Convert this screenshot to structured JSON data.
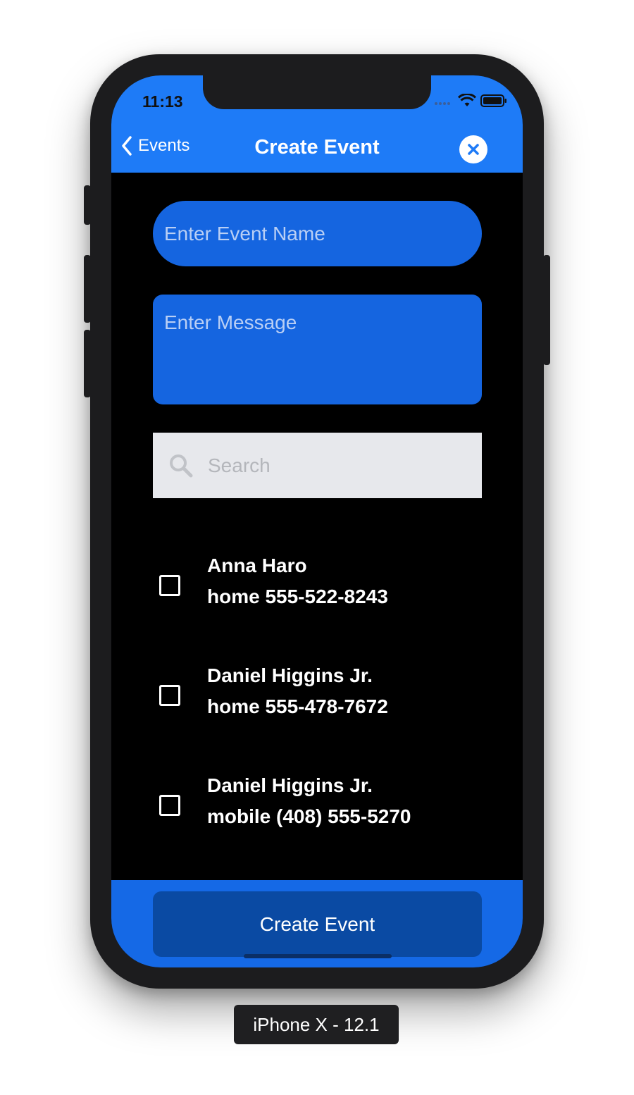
{
  "status_bar": {
    "time": "11:13"
  },
  "nav": {
    "back_label": "Events",
    "title": "Create Event",
    "close_icon": "close-circle-icon"
  },
  "form": {
    "event_name_placeholder": "Enter Event Name",
    "message_placeholder": "Enter Message",
    "search_placeholder": "Search"
  },
  "contacts": [
    {
      "name": "Anna Haro",
      "phone": "home 555-522-8243",
      "checked": false
    },
    {
      "name": "Daniel Higgins Jr.",
      "phone": "home 555-478-7672",
      "checked": false
    },
    {
      "name": "Daniel Higgins Jr.",
      "phone": "mobile (408) 555-5270",
      "checked": false
    }
  ],
  "footer": {
    "create_label": "Create Event"
  },
  "device_label": "iPhone X - 12.1",
  "colors": {
    "nav_blue": "#1e7bf7",
    "field_blue": "#1565e0",
    "button_blue": "#0a4aa3",
    "background": "#000000"
  }
}
